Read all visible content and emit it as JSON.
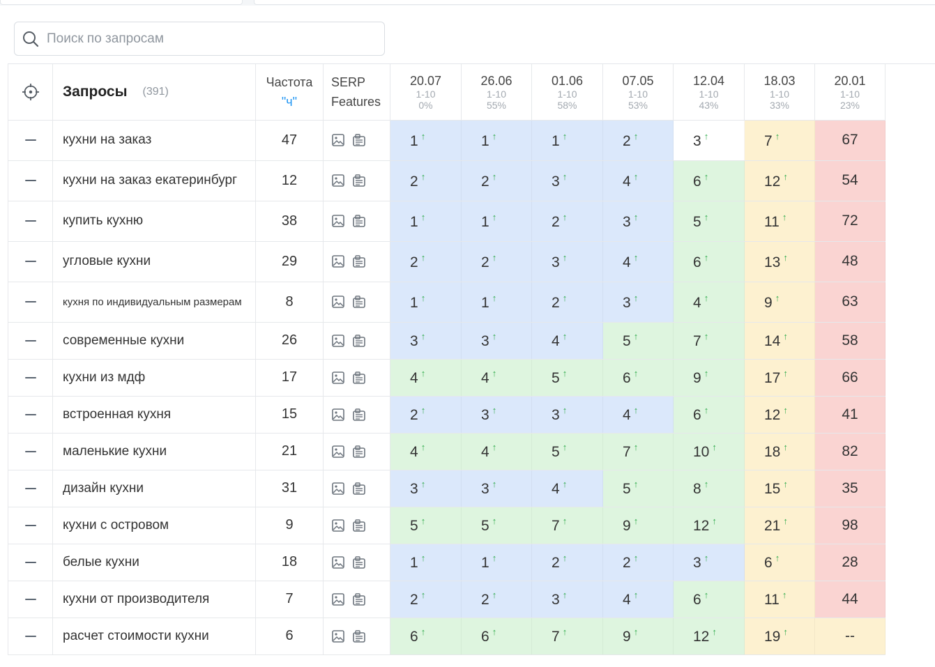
{
  "search": {
    "placeholder": "Поиск по запросам"
  },
  "table": {
    "headers": {
      "queries": "Запросы",
      "queries_count": "(391)",
      "frequency": "Частота",
      "frequency_sub": "\"ч\"",
      "serp_line1": "SERP",
      "serp_line2": "Features"
    },
    "dates": [
      {
        "date": "20.07",
        "range": "1-10",
        "pct": "0%"
      },
      {
        "date": "26.06",
        "range": "1-10",
        "pct": "55%"
      },
      {
        "date": "01.06",
        "range": "1-10",
        "pct": "58%"
      },
      {
        "date": "07.05",
        "range": "1-10",
        "pct": "53%"
      },
      {
        "date": "12.04",
        "range": "1-10",
        "pct": "43%"
      },
      {
        "date": "18.03",
        "range": "1-10",
        "pct": "33%"
      },
      {
        "date": "20.01",
        "range": "1-10",
        "pct": "23%"
      }
    ],
    "rows": [
      {
        "query": "кухни на заказ",
        "freq": "47",
        "pos": [
          "1",
          "1",
          "1",
          "2",
          "3",
          "7",
          "67"
        ]
      },
      {
        "query": "кухни на заказ екатеринбург",
        "freq": "12",
        "pos": [
          "2",
          "2",
          "3",
          "4",
          "6",
          "12",
          "54"
        ]
      },
      {
        "query": "купить кухню",
        "freq": "38",
        "pos": [
          "1",
          "1",
          "2",
          "3",
          "5",
          "11",
          "72"
        ]
      },
      {
        "query": "угловые кухни",
        "freq": "29",
        "pos": [
          "2",
          "2",
          "3",
          "4",
          "6",
          "13",
          "48"
        ]
      },
      {
        "query": "кухня по индивидуальным размерам",
        "freq": "8",
        "pos": [
          "1",
          "1",
          "2",
          "3",
          "4",
          "9",
          "63"
        ]
      },
      {
        "query": "современные кухни",
        "freq": "26",
        "pos": [
          "3",
          "3",
          "4",
          "5",
          "7",
          "14",
          "58"
        ]
      },
      {
        "query": "кухни из мдф",
        "freq": "17",
        "pos": [
          "4",
          "4",
          "5",
          "6",
          "9",
          "17",
          "66"
        ]
      },
      {
        "query": "встроенная кухня",
        "freq": "15",
        "pos": [
          "2",
          "3",
          "3",
          "4",
          "6",
          "12",
          "41"
        ]
      },
      {
        "query": "маленькие кухни",
        "freq": "21",
        "pos": [
          "4",
          "4",
          "5",
          "7",
          "10",
          "18",
          "82"
        ]
      },
      {
        "query": "дизайн кухни",
        "freq": "31",
        "pos": [
          "3",
          "3",
          "4",
          "5",
          "8",
          "15",
          "35"
        ]
      },
      {
        "query": "кухни с островом",
        "freq": "9",
        "pos": [
          "5",
          "5",
          "7",
          "9",
          "12",
          "21",
          "98"
        ]
      },
      {
        "query": "белые кухни",
        "freq": "18",
        "pos": [
          "1",
          "1",
          "2",
          "2",
          "3",
          "6",
          "28"
        ]
      },
      {
        "query": "кухни от производителя",
        "freq": "7",
        "pos": [
          "2",
          "2",
          "3",
          "4",
          "6",
          "11",
          "44"
        ]
      },
      {
        "query": "расчет стоимости кухни",
        "freq": "6",
        "pos": [
          "6",
          "6",
          "7",
          "9",
          "12",
          "19",
          "--"
        ]
      }
    ],
    "arrow": "↑"
  },
  "colors": {
    "top3": "#dbe8fb",
    "top10": "#def5df",
    "top30": "#fdf1d0",
    "beyond": "#fad4d2",
    "up_arrow": "#2eaa4a",
    "accent": "#2196f3"
  },
  "icons": {
    "search": "search-icon",
    "target": "target-icon",
    "collapse": "minus-icon",
    "serp_image": "image-icon",
    "serp_snippet": "snippet-icon"
  }
}
